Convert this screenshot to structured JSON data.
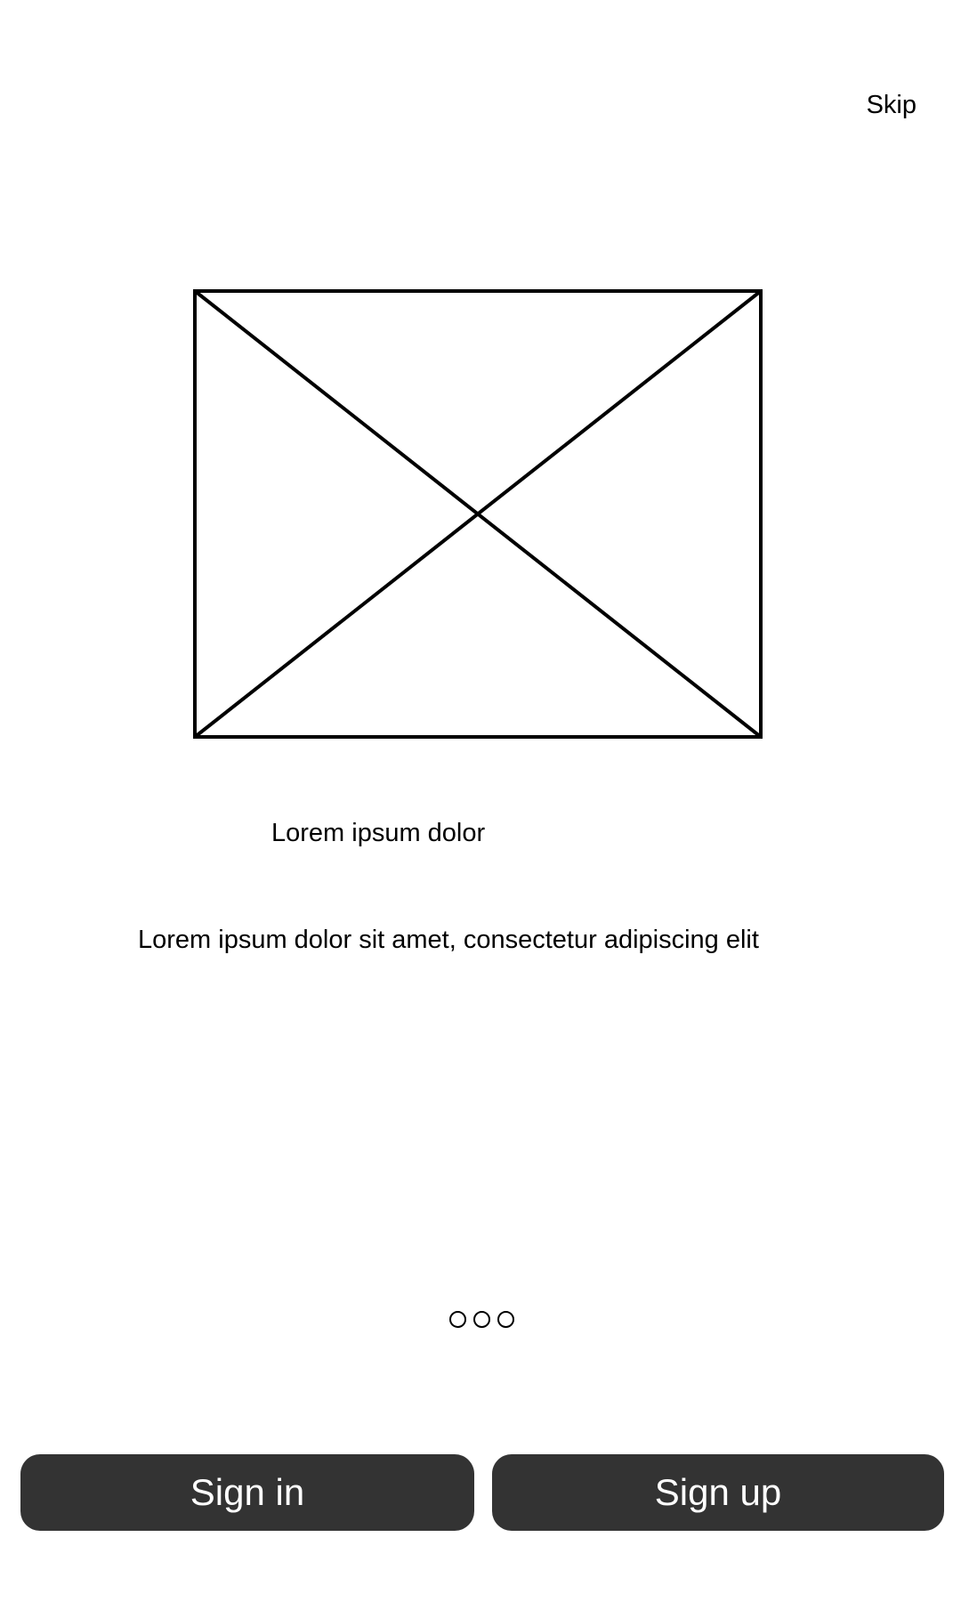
{
  "header": {
    "skip_label": "Skip"
  },
  "hero": {
    "image": "image-placeholder-icon"
  },
  "content": {
    "headline": "Lorem ipsum dolor",
    "description": "Lorem ipsum dolor sit amet, consectetur adipiscing elit"
  },
  "pager": {
    "page_count": 3
  },
  "actions": {
    "sign_in_label": "Sign in",
    "sign_up_label": "Sign up"
  },
  "colors": {
    "button_background": "#333333",
    "button_text": "#ffffff",
    "background": "#ffffff",
    "text": "#000000"
  }
}
